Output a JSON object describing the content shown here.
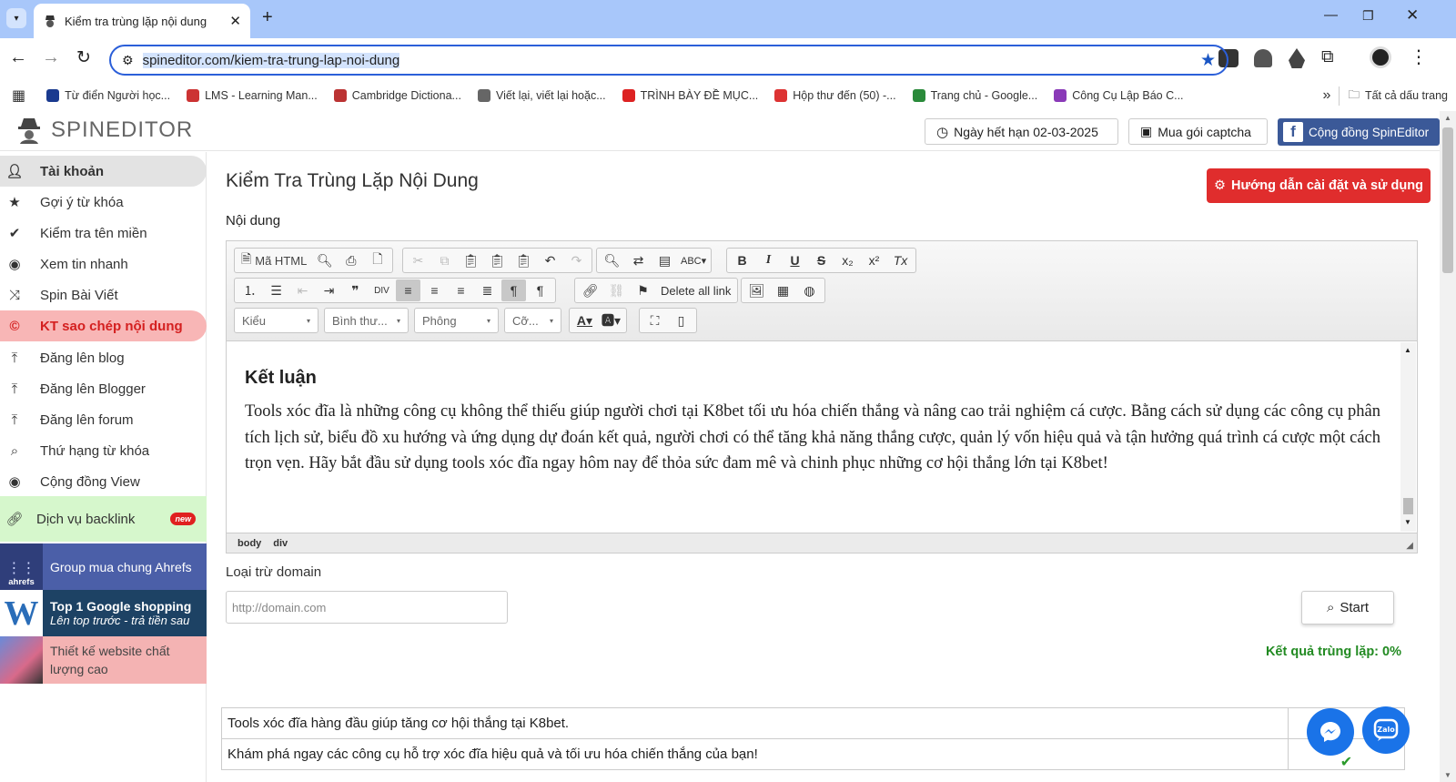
{
  "browser": {
    "tab_title": "Kiểm tra trùng lặp nội dung",
    "url": "spineditor.com/kiem-tra-trung-lap-noi-dung",
    "bookmarks": [
      {
        "label": "Từ điển Người học...",
        "icon": "dictionary-icon"
      },
      {
        "label": "LMS - Learning Man...",
        "icon": "lms-icon"
      },
      {
        "label": "Cambridge Dictiona...",
        "icon": "cambridge-icon"
      },
      {
        "label": "Viết lại, viết lại hoặc...",
        "icon": "quill-icon"
      },
      {
        "label": "TRÌNH BÀY ĐỀ MỤC...",
        "icon": "red-doc-icon"
      },
      {
        "label": "Hộp thư đến (50) -...",
        "icon": "gmail-icon"
      },
      {
        "label": "Trang chủ - Google...",
        "icon": "drive-icon"
      },
      {
        "label": "Công Cụ Lập Báo C...",
        "icon": "infinity-icon"
      }
    ],
    "all_bookmarks_label": "Tất cả dấu trang"
  },
  "site": {
    "logo_text": "SPINEDITOR",
    "expiry_label": "Ngày hết hạn 02-03-2025",
    "captcha_label": "Mua gói captcha",
    "community_label": "Cộng đồng SpinEditor"
  },
  "sidebar": {
    "items": [
      {
        "label": "Tài khoản",
        "icon": "user-icon"
      },
      {
        "label": "Gợi ý từ khóa",
        "icon": "star-icon"
      },
      {
        "label": "Kiểm tra tên miền",
        "icon": "check-icon"
      },
      {
        "label": "Xem tin nhanh",
        "icon": "eye-icon"
      },
      {
        "label": "Spin Bài Viết",
        "icon": "shuffle-icon"
      },
      {
        "label": "KT sao chép nội dung",
        "icon": "copyright-icon"
      },
      {
        "label": "Đăng lên blog",
        "icon": "upload-icon"
      },
      {
        "label": "Đăng lên Blogger",
        "icon": "upload-icon"
      },
      {
        "label": "Đăng lên forum",
        "icon": "upload-icon"
      },
      {
        "label": "Thứ hạng từ khóa",
        "icon": "search-icon"
      },
      {
        "label": "Cộng đồng View",
        "icon": "eye-icon"
      },
      {
        "label": "Dịch vụ backlink",
        "icon": "link-icon",
        "badge": "new"
      }
    ],
    "banners": {
      "ahrefs_logo": "ahrefs",
      "ahrefs": "Group mua chung Ahrefs",
      "shopping_title": "Top 1 Google shopping",
      "shopping_sub": "Lên top trước - trả tiền sau",
      "website": "Thiết kế website chất lượng cao"
    }
  },
  "main": {
    "title": "Kiểm Tra Trùng Lặp Nội Dung",
    "help_button": "Hướng dẫn cài đặt và sử dụng",
    "content_label": "Nội dung",
    "toolbar": {
      "html_button": "Mã HTML",
      "delete_links": "Delete all link",
      "style_combo": "Kiểu",
      "format_combo": "Bình thư...",
      "font_combo": "Phông",
      "size_combo": "Cỡ..."
    },
    "editor": {
      "heading": "Kết luận",
      "paragraph": "Tools xóc đĩa là những công cụ không thể thiếu giúp người chơi tại K8bet tối ưu hóa chiến thắng và nâng cao trải nghiệm cá cược. Bằng cách sử dụng các công cụ phân tích lịch sử, biểu đồ xu hướng và ứng dụng dự đoán kết quả, người chơi có thể tăng khả năng thắng cược, quản lý vốn hiệu quả và tận hưởng quá trình cá cược một cách trọn vẹn. Hãy bắt đầu sử dụng tools xóc đĩa ngay hôm nay để thỏa sức đam mê và chinh phục những cơ hội thắng lớn tại K8bet!",
      "path": [
        "body",
        "div"
      ]
    },
    "exclude_label": "Loại trừ domain",
    "exclude_placeholder": "http://domain.com",
    "start_button": "Start",
    "result_text": "Kết quả trùng lặp: 0%",
    "rows": [
      "Tools xóc đĩa hàng đầu giúp tăng cơ hội thắng tại K8bet.",
      "Khám phá ngay các công cụ hỗ trợ xóc đĩa hiệu quả và tối ưu hóa chiến thắng của bạn!"
    ]
  },
  "colors": {
    "accent_red": "#e02d2d",
    "active_item_bg": "#f8b6b6",
    "result_green": "#218a21",
    "facebook": "#3b5998"
  }
}
